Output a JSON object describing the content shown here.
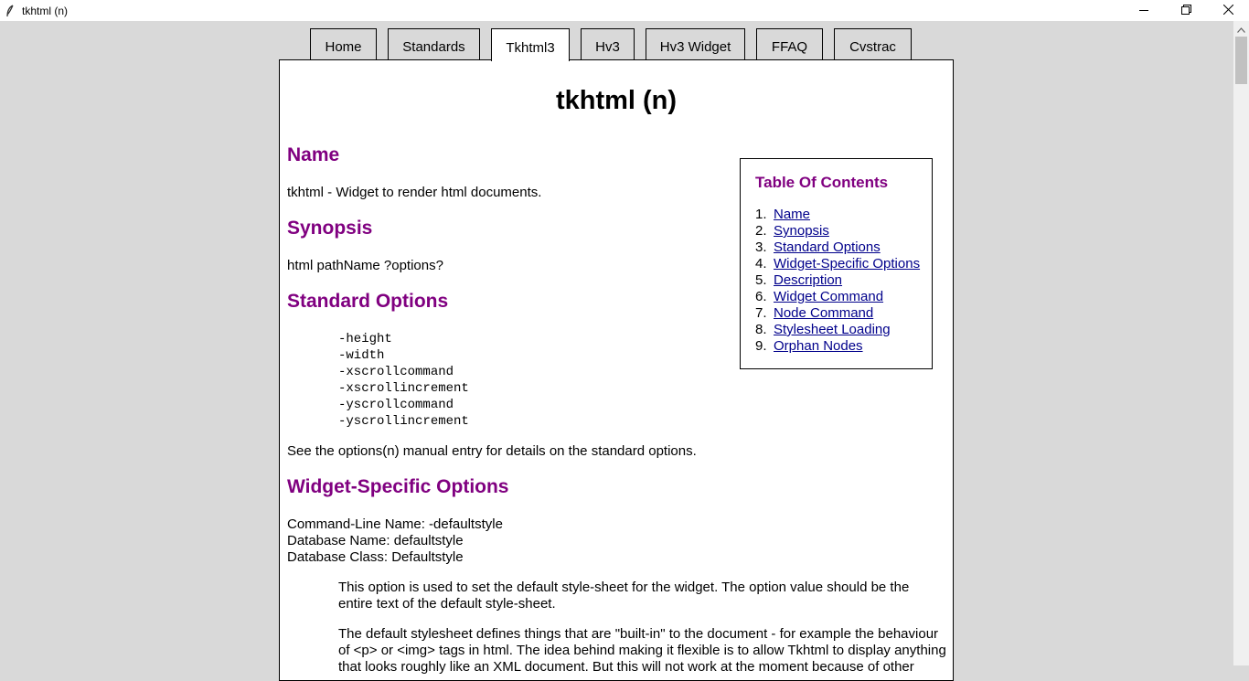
{
  "window": {
    "title": "tkhtml (n)",
    "controls": [
      "minimize-icon",
      "restore-icon",
      "close-icon"
    ]
  },
  "tabs": [
    {
      "label": "Home",
      "active": false
    },
    {
      "label": "Standards",
      "active": false
    },
    {
      "label": "Tkhtml3",
      "active": true
    },
    {
      "label": "Hv3",
      "active": false
    },
    {
      "label": "Hv3 Widget",
      "active": false
    },
    {
      "label": "FFAQ",
      "active": false
    },
    {
      "label": "Cvstrac",
      "active": false
    }
  ],
  "colors": {
    "heading": "#800080",
    "link": "#00008b",
    "background": "#d9d9d9"
  },
  "doc": {
    "title": "tkhtml (n)",
    "name_heading": "Name",
    "name_text": "tkhtml - Widget to render html documents.",
    "synopsis_heading": "Synopsis",
    "synopsis_text": "html pathName ?options?",
    "std_heading": "Standard Options",
    "std_options": [
      "-height",
      "-width",
      "-xscrollcommand",
      "-xscrollincrement",
      "-yscrollcommand",
      "-yscrollincrement"
    ],
    "std_note": "See the options(n) manual entry for details on the standard options.",
    "wso_heading": "Widget-Specific Options",
    "cmdline": "Command-Line Name: -defaultstyle",
    "dbname": "Database Name: defaultstyle",
    "dbclass": "Database Class: Defaultstyle",
    "para1": "This option is used to set the default style-sheet for the widget. The option value should be the entire text of the default style-sheet.",
    "para2": "The default stylesheet defines things that are \"built-in\" to the document - for example the behaviour of <p> or <img> tags in html. The idea behind making it flexible is to allow Tkhtml to display anything that looks roughly like an XML document. But this will not work at the moment because of other"
  },
  "toc": {
    "title": "Table Of Contents",
    "items": [
      {
        "num": "1.",
        "label": "Name"
      },
      {
        "num": "2.",
        "label": "Synopsis"
      },
      {
        "num": "3.",
        "label": "Standard Options"
      },
      {
        "num": "4.",
        "label": "Widget-Specific Options"
      },
      {
        "num": "5.",
        "label": "Description"
      },
      {
        "num": "6.",
        "label": "Widget Command"
      },
      {
        "num": "7.",
        "label": "Node Command"
      },
      {
        "num": "8.",
        "label": "Stylesheet Loading"
      },
      {
        "num": "9.",
        "label": "Orphan Nodes"
      }
    ]
  }
}
